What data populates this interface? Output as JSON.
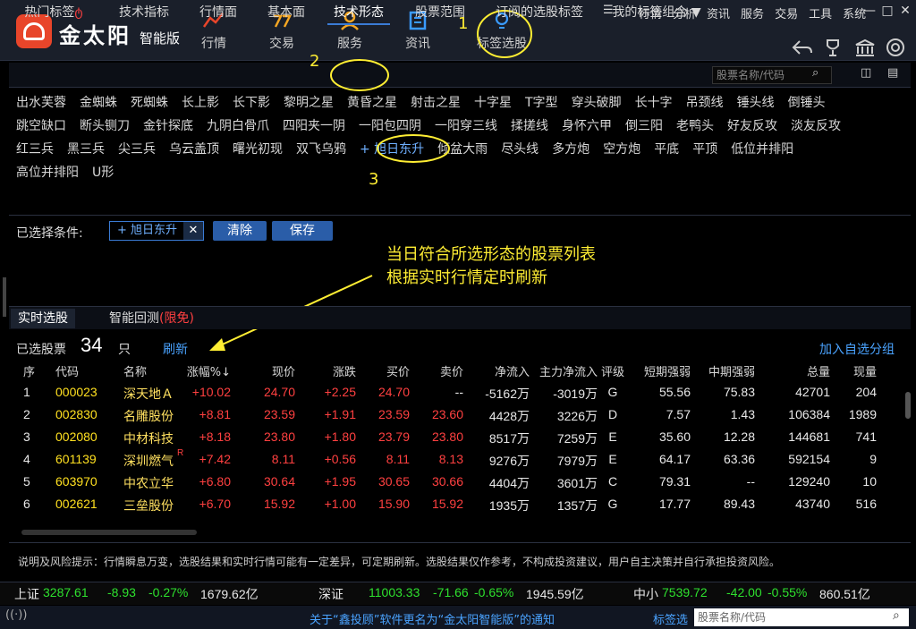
{
  "brand": {
    "name": "金太阳",
    "edition": "智能版"
  },
  "nav": [
    {
      "label": "行情",
      "icon": "trend-icon"
    },
    {
      "label": "交易",
      "icon": "trade-icon"
    },
    {
      "label": "服务",
      "icon": "user-icon"
    },
    {
      "label": "资讯",
      "icon": "news-icon"
    },
    {
      "label": "标签选股",
      "icon": "lightbulb-icon"
    }
  ],
  "sysmenu": [
    "行情",
    "分析",
    "资讯",
    "服务",
    "交易",
    "工具",
    "系统"
  ],
  "tabs": [
    "热门标签",
    "技术指标",
    "行情面",
    "基本面",
    "技术形态",
    "股票范围",
    "订阅的选股标签",
    "我的标签组合"
  ],
  "search_placeholder": "股票名称/代码",
  "patterns": {
    "row1": [
      "出水芙蓉",
      "金蜘蛛",
      "死蜘蛛",
      "长上影",
      "长下影",
      "黎明之星",
      "黄昏之星",
      "射击之星",
      "十字星",
      "T字型",
      "穿头破脚",
      "长十字",
      "吊颈线",
      "锤头线",
      "倒锤头"
    ],
    "row2": [
      "跳空缺口",
      "断头铡刀",
      "金针探底",
      "九阴白骨爪",
      "四阳夹一阴",
      "一阳包四阴",
      "一阳穿三线",
      "揉搓线",
      "身怀六甲",
      "倒三阳",
      "老鸭头",
      "好友反攻",
      "淡友反攻"
    ],
    "row3": [
      "红三兵",
      "黑三兵",
      "尖三兵",
      "乌云盖顶",
      "曙光初现",
      "双飞乌鸦",
      "+ 旭日东升",
      "倾盆大雨",
      "尽头线",
      "多方炮",
      "空方炮",
      "平底",
      "平顶",
      "低位并排阳"
    ],
    "row4": [
      "高位并排阳",
      "U形"
    ]
  },
  "selected": {
    "label": "已选择条件:",
    "chip": "+ 旭日东升",
    "clear": "清除",
    "save": "保存"
  },
  "annotation": {
    "line1": "当日符合所选形态的股票列表",
    "line2": "根据实时行情定时刷新",
    "n1": "1",
    "n2": "2",
    "n3": "3"
  },
  "result_tabs": [
    "实时选股",
    "智能回测"
  ],
  "result_tab_extra": "(限免)",
  "count": {
    "label": "已选股票",
    "value": "34",
    "unit": "只",
    "refresh": "刷新",
    "add": "加入自选分组"
  },
  "headers": [
    "序",
    "代码",
    "名称",
    "涨幅%↓",
    "现价",
    "涨跌",
    "买价",
    "卖价",
    "净流入",
    "主力净流入",
    "评级",
    "短期强弱",
    "中期强弱",
    "总量",
    "现量"
  ],
  "rows": [
    [
      "1",
      "000023",
      "深天地Ａ",
      "+10.02",
      "24.70",
      "+2.25",
      "24.70",
      "--",
      "-5162万",
      "-3019万",
      "G",
      "55.56",
      "75.83",
      "42701",
      "204"
    ],
    [
      "2",
      "002830",
      "名雕股份",
      "+8.81",
      "23.59",
      "+1.91",
      "23.59",
      "23.60",
      "4428万",
      "3226万",
      "D",
      "7.57",
      "1.43",
      "106384",
      "1989"
    ],
    [
      "3",
      "002080",
      "中材科技",
      "+8.18",
      "23.80",
      "+1.80",
      "23.79",
      "23.80",
      "8517万",
      "7259万",
      "E",
      "35.60",
      "12.28",
      "144681",
      "741"
    ],
    [
      "4",
      "601139",
      "深圳燃气",
      "+7.42",
      "8.11",
      "+0.56",
      "8.11",
      "8.13",
      "9276万",
      "7979万",
      "E",
      "64.17",
      "63.36",
      "592154",
      "9"
    ],
    [
      "5",
      "603970",
      "中农立华",
      "+6.80",
      "30.64",
      "+1.95",
      "30.65",
      "30.66",
      "4404万",
      "3601万",
      "C",
      "79.31",
      "--",
      "129240",
      "10"
    ],
    [
      "6",
      "002621",
      "三垒股份",
      "+6.70",
      "15.92",
      "+1.00",
      "15.90",
      "15.92",
      "1935万",
      "1357万",
      "G",
      "17.77",
      "89.43",
      "43740",
      "516"
    ]
  ],
  "row4_badge": "R",
  "note": "说明及风险提示：行情瞬息万变，选股结果和实时行情可能有一定差异，可定期刷新。选股结果仅作参考，不构成投资建议，用户自主决策并自行承担投资风险。",
  "indices": [
    {
      "name": "上证",
      "value": "3287.61",
      "chg": "-8.93",
      "pct": "-0.27%",
      "amt": "1679.62亿"
    },
    {
      "name": "深证",
      "value": "11003.33",
      "chg": "-71.66",
      "pct": "-0.65%",
      "amt": "1945.59亿"
    },
    {
      "name": "中小",
      "value": "7539.72",
      "chg": "-42.00",
      "pct": "-0.55%",
      "amt": "860.51亿"
    }
  ],
  "bottom": {
    "notice": "关于“鑫投顾”软件更名为“金太阳智能版”的通知",
    "tag": "标签选",
    "search": "股票名称/代码"
  },
  "colors": {
    "up": "#ff4040",
    "down": "#2ee02e",
    "accent": "#3a7bd5",
    "annotation": "#ffee33"
  }
}
